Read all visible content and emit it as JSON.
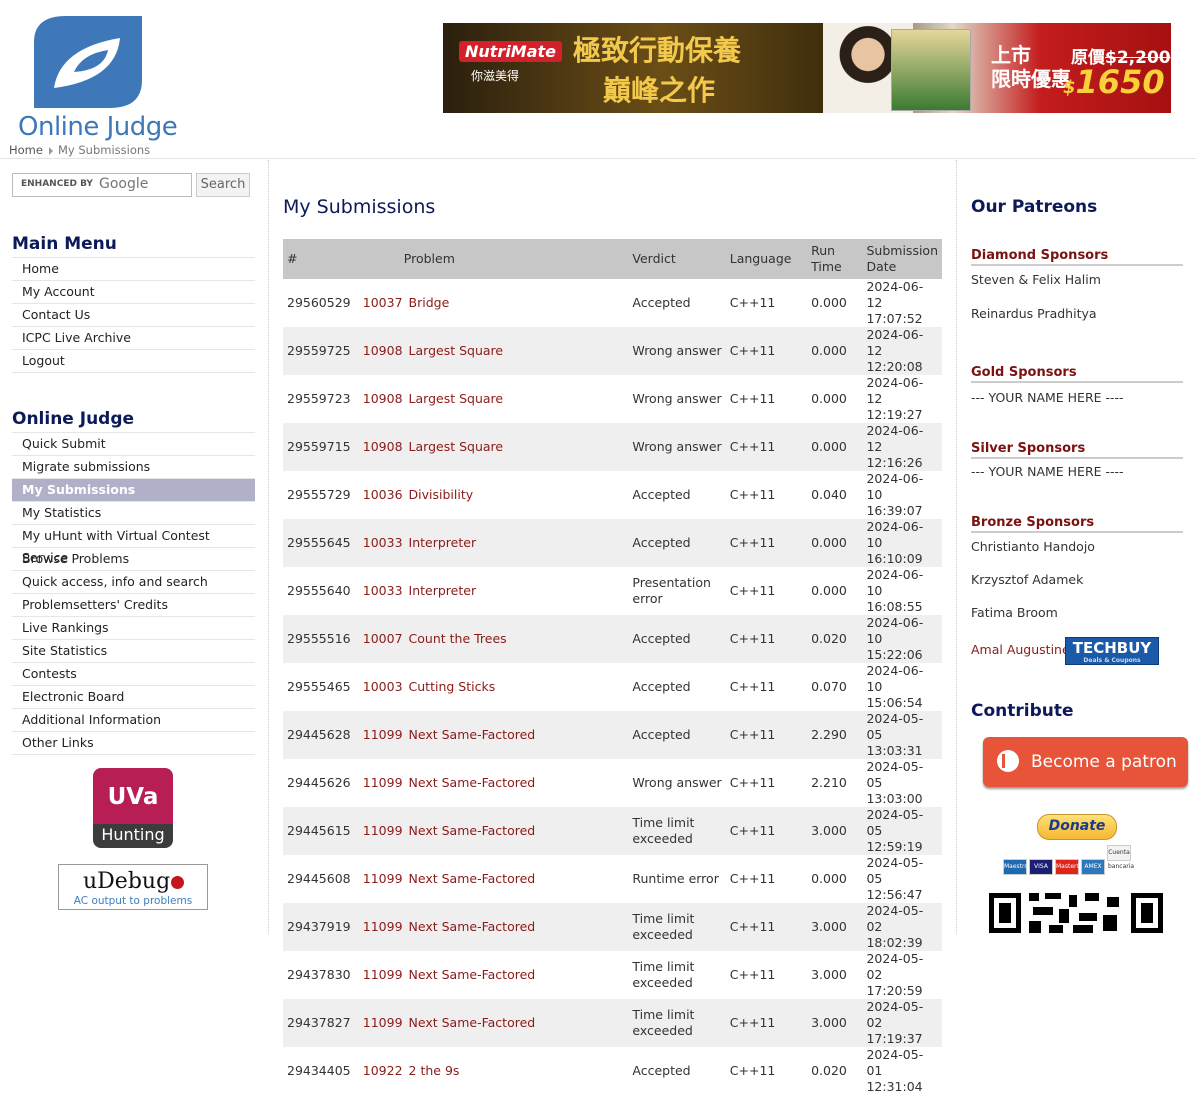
{
  "header": {
    "logo_text": "Online Judge",
    "breadcrumb": {
      "home": "Home",
      "current": "My Submissions"
    },
    "ad": {
      "brand": "NutriMate",
      "brand_sub": "你滋美得",
      "slogan_line1": "極致行動保養",
      "slogan_line2": "巔峰之作",
      "launch_line1": "上市",
      "launch_line2": "限時優惠",
      "original_price_label": "原價",
      "original_price": "$2,200",
      "price_symbol": "$",
      "price": "1650"
    }
  },
  "search": {
    "enhanced_by": "ENHANCED BY",
    "google": "Google",
    "button": "Search"
  },
  "main_menu": {
    "title": "Main Menu",
    "items": [
      "Home",
      "My Account",
      "Contact Us",
      "ICPC Live Archive",
      "Logout"
    ]
  },
  "oj_menu": {
    "title": "Online Judge",
    "items": [
      "Quick Submit",
      "Migrate submissions",
      "My Submissions",
      "My Statistics",
      "My uHunt with Virtual Contest Service",
      "Browse Problems",
      "Quick access, info and search",
      "Problemsetters' Credits",
      "Live Rankings",
      "Site Statistics",
      "Contests",
      "Electronic Board",
      "Additional Information",
      "Other Links"
    ],
    "active_index": 2
  },
  "uva": {
    "top": "UVa",
    "bottom": "Hunting"
  },
  "udebug": {
    "title": "uDebug",
    "subtitle": "AC output to problems"
  },
  "page": {
    "title": "My Submissions"
  },
  "table": {
    "headers": {
      "id": "#",
      "problem": "Problem",
      "verdict": "Verdict",
      "language": "Language",
      "runtime_line1": "Run",
      "runtime_line2": "Time",
      "date_line1": "Submission",
      "date_line2": "Date"
    },
    "rows": [
      {
        "id": "29560529",
        "pnum": "10037",
        "pname": "Bridge",
        "verdict": "Accepted",
        "lang": "C++11",
        "time": "0.000",
        "date": "2024-06-12",
        "clock": "17:07:52"
      },
      {
        "id": "29559725",
        "pnum": "10908",
        "pname": "Largest Square",
        "verdict": "Wrong answer",
        "lang": "C++11",
        "time": "0.000",
        "date": "2024-06-12",
        "clock": "12:20:08"
      },
      {
        "id": "29559723",
        "pnum": "10908",
        "pname": "Largest Square",
        "verdict": "Wrong answer",
        "lang": "C++11",
        "time": "0.000",
        "date": "2024-06-12",
        "clock": "12:19:27"
      },
      {
        "id": "29559715",
        "pnum": "10908",
        "pname": "Largest Square",
        "verdict": "Wrong answer",
        "lang": "C++11",
        "time": "0.000",
        "date": "2024-06-12",
        "clock": "12:16:26"
      },
      {
        "id": "29555729",
        "pnum": "10036",
        "pname": "Divisibility",
        "verdict": "Accepted",
        "lang": "C++11",
        "time": "0.040",
        "date": "2024-06-10",
        "clock": "16:39:07"
      },
      {
        "id": "29555645",
        "pnum": "10033",
        "pname": "Interpreter",
        "verdict": "Accepted",
        "lang": "C++11",
        "time": "0.000",
        "date": "2024-06-10",
        "clock": "16:10:09"
      },
      {
        "id": "29555640",
        "pnum": "10033",
        "pname": "Interpreter",
        "verdict": "Presentation error",
        "lang": "C++11",
        "time": "0.000",
        "date": "2024-06-10",
        "clock": "16:08:55"
      },
      {
        "id": "29555516",
        "pnum": "10007",
        "pname": "Count the Trees",
        "verdict": "Accepted",
        "lang": "C++11",
        "time": "0.020",
        "date": "2024-06-10",
        "clock": "15:22:06"
      },
      {
        "id": "29555465",
        "pnum": "10003",
        "pname": "Cutting Sticks",
        "verdict": "Accepted",
        "lang": "C++11",
        "time": "0.070",
        "date": "2024-06-10",
        "clock": "15:06:54"
      },
      {
        "id": "29445628",
        "pnum": "11099",
        "pname": "Next Same-Factored",
        "verdict": "Accepted",
        "lang": "C++11",
        "time": "2.290",
        "date": "2024-05-05",
        "clock": "13:03:31"
      },
      {
        "id": "29445626",
        "pnum": "11099",
        "pname": "Next Same-Factored",
        "verdict": "Wrong answer",
        "lang": "C++11",
        "time": "2.210",
        "date": "2024-05-05",
        "clock": "13:03:00"
      },
      {
        "id": "29445615",
        "pnum": "11099",
        "pname": "Next Same-Factored",
        "verdict": "Time limit exceeded",
        "lang": "C++11",
        "time": "3.000",
        "date": "2024-05-05",
        "clock": "12:59:19"
      },
      {
        "id": "29445608",
        "pnum": "11099",
        "pname": "Next Same-Factored",
        "verdict": "Runtime error",
        "lang": "C++11",
        "time": "0.000",
        "date": "2024-05-05",
        "clock": "12:56:47"
      },
      {
        "id": "29437919",
        "pnum": "11099",
        "pname": "Next Same-Factored",
        "verdict": "Time limit exceeded",
        "lang": "C++11",
        "time": "3.000",
        "date": "2024-05-02",
        "clock": "18:02:39"
      },
      {
        "id": "29437830",
        "pnum": "11099",
        "pname": "Next Same-Factored",
        "verdict": "Time limit exceeded",
        "lang": "C++11",
        "time": "3.000",
        "date": "2024-05-02",
        "clock": "17:20:59"
      },
      {
        "id": "29437827",
        "pnum": "11099",
        "pname": "Next Same-Factored",
        "verdict": "Time limit exceeded",
        "lang": "C++11",
        "time": "3.000",
        "date": "2024-05-02",
        "clock": "17:19:37"
      },
      {
        "id": "29434405",
        "pnum": "10922",
        "pname": "2 the 9s",
        "verdict": "Accepted",
        "lang": "C++11",
        "time": "0.020",
        "date": "2024-05-01",
        "clock": "12:31:04"
      }
    ]
  },
  "patreons": {
    "title": "Our Patreons",
    "diamond": {
      "label": "Diamond Sponsors",
      "names": [
        "Steven & Felix Halim",
        "Reinardus Pradhitya"
      ]
    },
    "gold": {
      "label": "Gold Sponsors",
      "names": [
        "--- YOUR NAME HERE ----"
      ]
    },
    "silver": {
      "label": "Silver Sponsors",
      "names": [
        "--- YOUR NAME HERE ----"
      ]
    },
    "bronze": {
      "label": "Bronze Sponsors",
      "names": [
        "Christianto Handojo",
        "Krzysztof Adamek",
        "Fatima Broom",
        "Amal Augustine"
      ]
    },
    "techbuy": "TECHBUY",
    "techbuy_sub": "Deals & Coupons"
  },
  "contribute": {
    "title": "Contribute",
    "patron_button": "Become a patron",
    "donate": "Donate",
    "cards": [
      "Maestro",
      "VISA",
      "MasterCard",
      "AMEX",
      "Cuenta bancaria"
    ]
  },
  "colors": {
    "menu_title": "#0d1a5a",
    "problem_link": "#8b1a1a",
    "sponsor_head": "#7b1212",
    "active_menu": "#b0b1c9",
    "patreon_orange": "#e8543a"
  }
}
